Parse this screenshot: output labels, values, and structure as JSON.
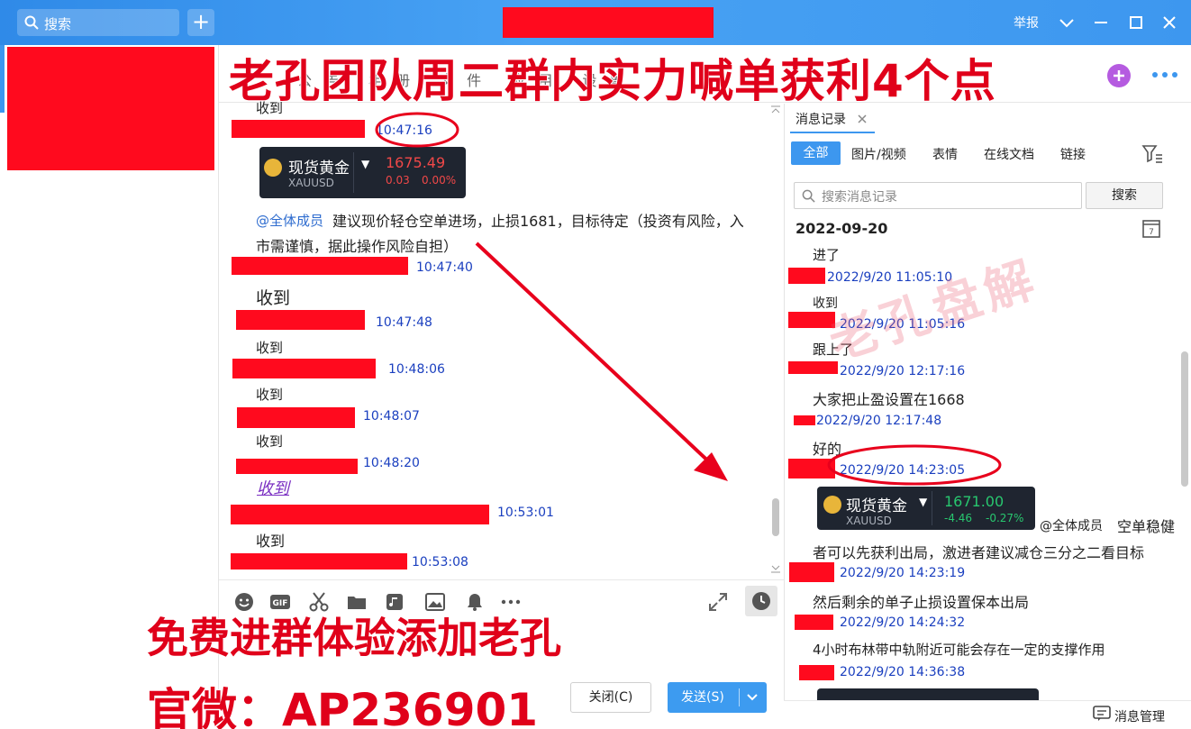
{
  "titlebar": {
    "search_placeholder": "搜索",
    "add_label": "+",
    "report_label": "举报"
  },
  "chat_tabs_hint": "公告 相册 文件 应用 设置",
  "chat": {
    "messages": [
      {
        "text": "收到",
        "time": "10:47:16"
      },
      {
        "card": "gold1",
        "text": "@全体成员",
        "body": "建议现价轻仓空单进场，止损1681，目标待定（投资有风险，入",
        "body2": "市需谨慎，据此操作风险自担）",
        "time": "10:47:40"
      },
      {
        "text": "收到",
        "time": "10:47:48"
      },
      {
        "text": "收到",
        "time": "10:48:06"
      },
      {
        "text": "收到",
        "time": "10:48:07"
      },
      {
        "text": "收到",
        "time": "10:48:20"
      },
      {
        "text": "收到",
        "time": "10:53:01"
      },
      {
        "text": "收到",
        "time": "10:53:08"
      }
    ]
  },
  "gold_cards": {
    "gold1": {
      "name": "现货黄金",
      "symbol": "XAUUSD",
      "price": "1675.49",
      "change": "0.03",
      "pct": "0.00%",
      "color": "#f04848"
    },
    "gold2": {
      "name": "现货黄金",
      "symbol": "XAUUSD",
      "price": "1671.00",
      "change": "-4.46",
      "pct": "-0.27%",
      "color": "#28c76f"
    }
  },
  "buttons": {
    "close": "关闭(C)",
    "send": "发送(S)"
  },
  "history": {
    "tab": "消息记录",
    "filters": [
      "全部",
      "图片/视频",
      "表情",
      "在线文档",
      "链接"
    ],
    "search_placeholder": "搜索消息记录",
    "search_btn": "搜索",
    "date": "2022-09-20",
    "items": [
      {
        "text": "进了",
        "time": "2022/9/20 11:05:10"
      },
      {
        "text": "收到",
        "time": "2022/9/20 11:05:16"
      },
      {
        "text": "跟上了",
        "time": "2022/9/20 12:17:16"
      },
      {
        "text": "大家把止盈设置在1668",
        "time": "2022/9/20 12:17:48"
      },
      {
        "text": "好的",
        "time": "2022/9/20 14:23:05"
      },
      {
        "mention": "@全体成员",
        "text": "空单稳健",
        "text2": "者可以先获利出局，激进者建议减仓三分之二看目标",
        "time": "2022/9/20 14:23:19"
      },
      {
        "text": "然后剩余的单子止损设置保本出局",
        "time": "2022/9/20 14:24:32"
      },
      {
        "text": "4小时布林带中轨附近可能会存在一定的支撑作用",
        "time": "2022/9/20 14:36:38"
      }
    ],
    "footer": "消息管理"
  },
  "overlays": {
    "headline": "老孔团队周二群内实力喊单获利4个点",
    "promo1": "免费进群体验添加老孔",
    "promo2": "官微：AP236901",
    "watermark": "老孔盘解"
  },
  "colors": {
    "accent": "#3d97ef",
    "redact": "#ff0a1e",
    "overlay_red": "#e0001a"
  }
}
